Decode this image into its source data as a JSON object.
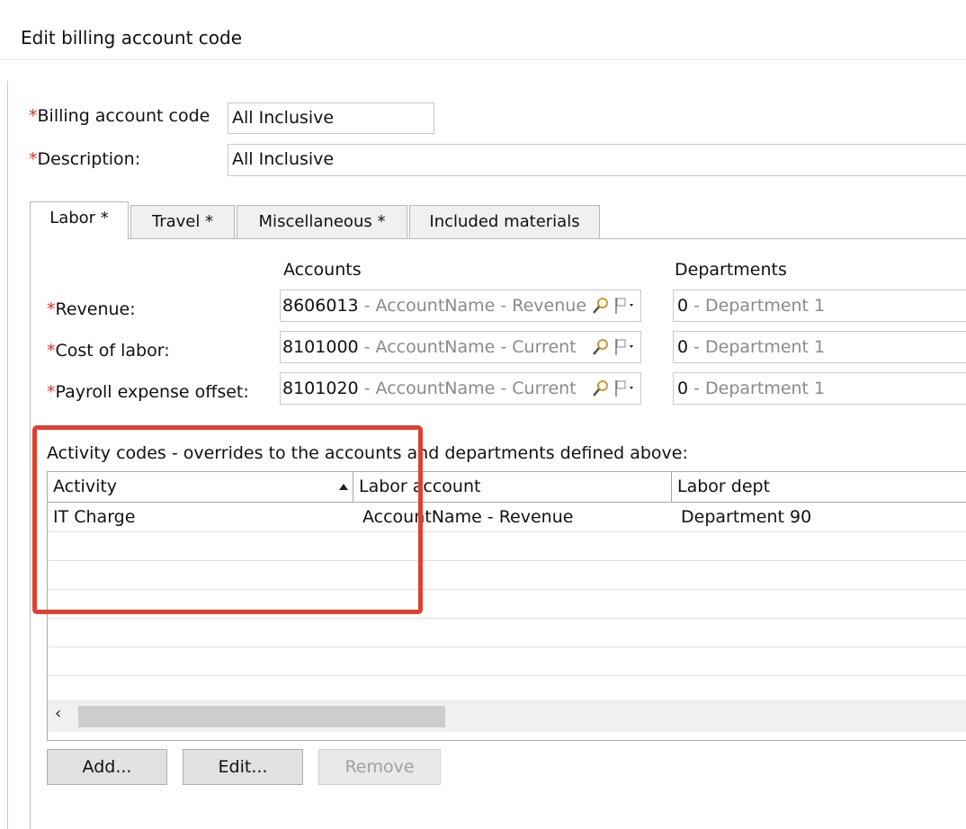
{
  "dialog": {
    "title": "Edit billing account code"
  },
  "form": {
    "required_mark": "*",
    "billing_code": {
      "label": "Billing account code",
      "value": "All Inclusive"
    },
    "description": {
      "label": "Description:",
      "value": "All Inclusive"
    }
  },
  "tabs": [
    {
      "label": "Labor *",
      "active": true
    },
    {
      "label": "Travel *",
      "active": false
    },
    {
      "label": "Miscellaneous *",
      "active": false
    },
    {
      "label": "Included materials",
      "active": false
    }
  ],
  "labor": {
    "accounts_header": "Accounts",
    "departments_header": "Departments",
    "rows": [
      {
        "label": "Revenue:",
        "account_code": "8606013",
        "account_desc": " - AccountName - Revenue",
        "dept_code": "0",
        "dept_desc": " - Department 1"
      },
      {
        "label": "Cost of labor:",
        "account_code": "8101000",
        "account_desc": " - AccountName - Current",
        "dept_code": "0",
        "dept_desc": " - Department 1"
      },
      {
        "label": "Payroll expense offset:",
        "account_code": "8101020",
        "account_desc": " - AccountName - Current",
        "dept_code": "0",
        "dept_desc": " - Department 1"
      }
    ]
  },
  "activity": {
    "caption": "Activity codes - overrides to the accounts and departments defined above:",
    "columns": [
      "Activity",
      "Labor account",
      "Labor dept"
    ],
    "rows": [
      {
        "activity": "IT Charge",
        "labor_account": "AccountName - Revenue",
        "labor_dept": "Department 90"
      }
    ],
    "scroll_left": "‹"
  },
  "buttons": {
    "add": "Add...",
    "edit": "Edit...",
    "remove": "Remove"
  },
  "colors": {
    "required": "#d9342b",
    "highlight": "#e0402f"
  }
}
